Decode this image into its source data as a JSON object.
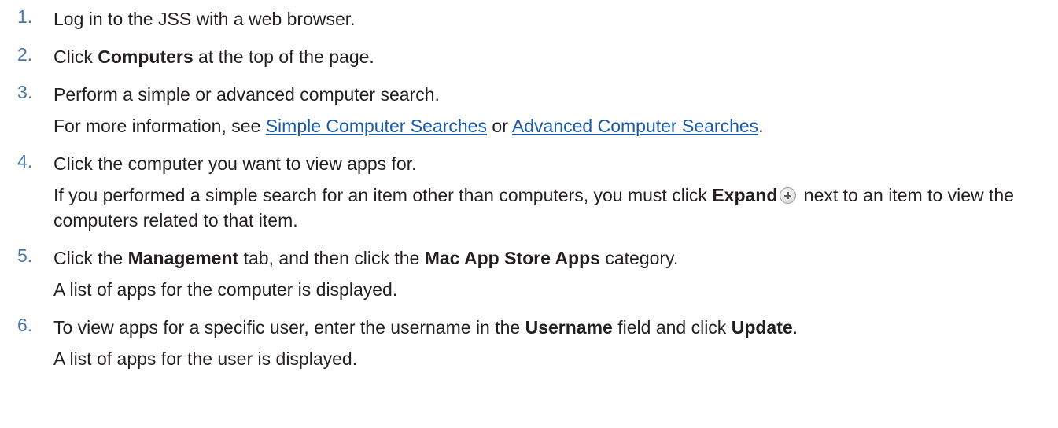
{
  "steps": [
    {
      "num": "1.",
      "line": [
        "Log in to the JSS with a web browser."
      ]
    },
    {
      "num": "2.",
      "line": [
        "Click ",
        "Computers",
        " at the top of the page."
      ]
    },
    {
      "num": "3.",
      "line": [
        "Perform a simple or advanced computer search."
      ],
      "sub": [
        "For more information, see ",
        "Simple Computer Searches",
        " or ",
        "Advanced Computer Searches",
        "."
      ]
    },
    {
      "num": "4.",
      "line": [
        "Click the computer you want to view apps for."
      ],
      "sub": [
        "If you performed a simple search for an item other than computers, you must click ",
        "Expand",
        " next to an item to view the computers related to that item."
      ]
    },
    {
      "num": "5.",
      "line": [
        "Click the ",
        "Management",
        " tab, and then click the ",
        "Mac App Store Apps",
        " category."
      ],
      "sub": [
        "A list of apps for the computer is displayed."
      ]
    },
    {
      "num": "6.",
      "line": [
        "To view apps for a specific user, enter the username in the ",
        "Username",
        " field and click ",
        "Update",
        "."
      ],
      "sub": [
        "A list of apps for the user is displayed."
      ]
    }
  ],
  "icons": {
    "expand": "plus-circle-icon"
  },
  "colors": {
    "step_number": "#4a78a8",
    "link": "#1a5aa6",
    "text": "#231f20"
  }
}
